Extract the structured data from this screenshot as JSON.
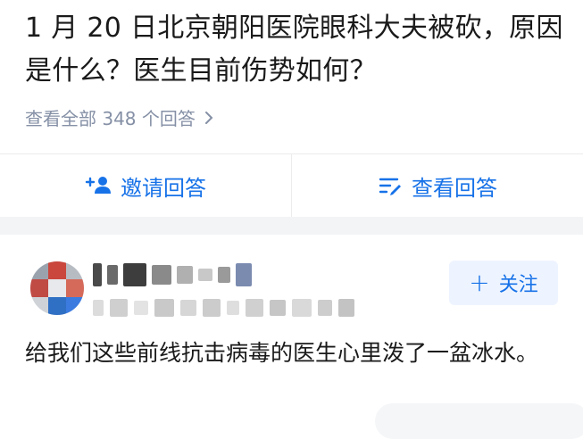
{
  "question": {
    "title": "1 月 20 日北京朝阳医院眼科大夫被砍，原因是什么？医生目前伤势如何？",
    "view_all_label": "查看全部 348 个回答"
  },
  "actions": {
    "invite_label": "邀请回答",
    "view_label": "查看回答"
  },
  "answer": {
    "follow_label": "关注",
    "text": "给我们这些前线抗击病毒的医生心里泼了一盆冰水。"
  },
  "colors": {
    "accent": "#1772e8",
    "muted": "#8590a6",
    "follow_bg": "#eef4ff",
    "band": "#f3f4f6"
  },
  "icons": {
    "invite": "add-user-icon",
    "view": "list-edit-icon",
    "chevron": "chevron-right-icon",
    "follow": "plus-icon"
  }
}
